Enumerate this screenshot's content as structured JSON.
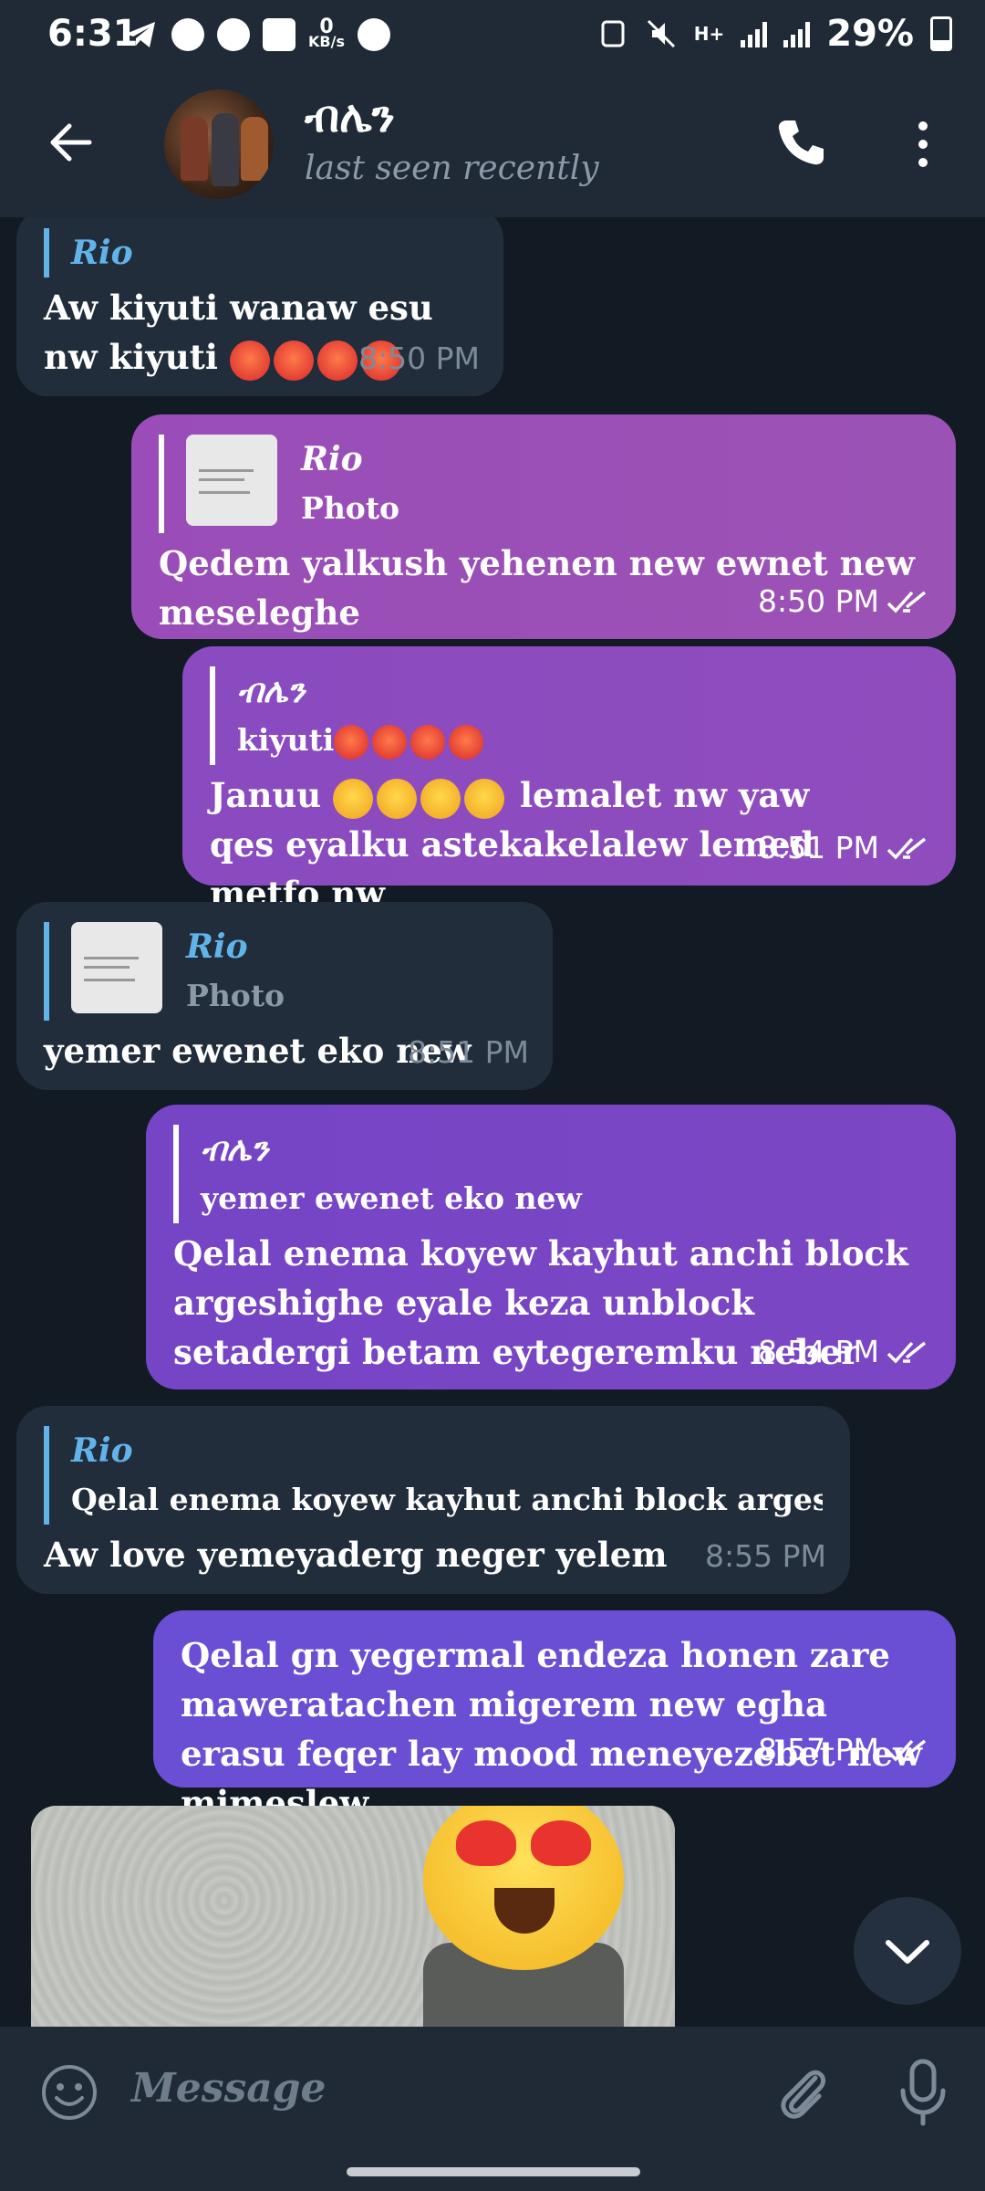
{
  "status_bar": {
    "time": "6:31",
    "net_speed_value": "0",
    "net_speed_unit": "KB/s",
    "network_label": "H+",
    "battery": "29%"
  },
  "header": {
    "contact_name": "ብሌን",
    "last_seen": "last seen recently"
  },
  "messages": [
    {
      "dir": "in",
      "quote_name": "Rio",
      "text_pre": "Aw kiyuti wanaw esu nw kiyuti",
      "time": "8:50 PM"
    },
    {
      "dir": "out",
      "quote_name": "Rio",
      "quote_text": "Photo",
      "text": "Qedem yalkush yehenen new ewnet new meseleghe",
      "time": "8:50 PM"
    },
    {
      "dir": "out",
      "quote_name": "ብሌን",
      "quote_text": "kiyuti",
      "text_a": "Januu",
      "text_b": "lemalet nw yaw qes eyalku astekakelalew lemed metfo nw",
      "time": "8:51 PM"
    },
    {
      "dir": "in",
      "quote_name": "Rio",
      "quote_text": "Photo",
      "text": "yemer ewenet eko new",
      "time": "8:51 PM"
    },
    {
      "dir": "out",
      "quote_name": "ብሌን",
      "quote_text": "yemer ewenet eko new",
      "text": "Qelal enema koyew kayhut anchi block argeshighe eyale keza unblock setadergi betam eytegeremku neber",
      "time": "8:54 PM"
    },
    {
      "dir": "in",
      "quote_name": "Rio",
      "quote_text": "Qelal enema koyew kayhut anchi block argeshighe eyal...",
      "text": "Aw love yemeyaderg neger yelem",
      "time": "8:55 PM"
    },
    {
      "dir": "out",
      "text": "Qelal gn yegermal endeza honen zare maweratachen migerem new egha erasu feqer lay mood meneyezebet new mimeslew",
      "time": "8:57 PM"
    }
  ],
  "input": {
    "placeholder": "Message"
  },
  "colors": {
    "bg": "#121b24",
    "bar": "#1f2a36",
    "incoming": "#212d3a",
    "accent_blue": "#61b3ea",
    "outgoing_purple": "#9b52b5"
  }
}
